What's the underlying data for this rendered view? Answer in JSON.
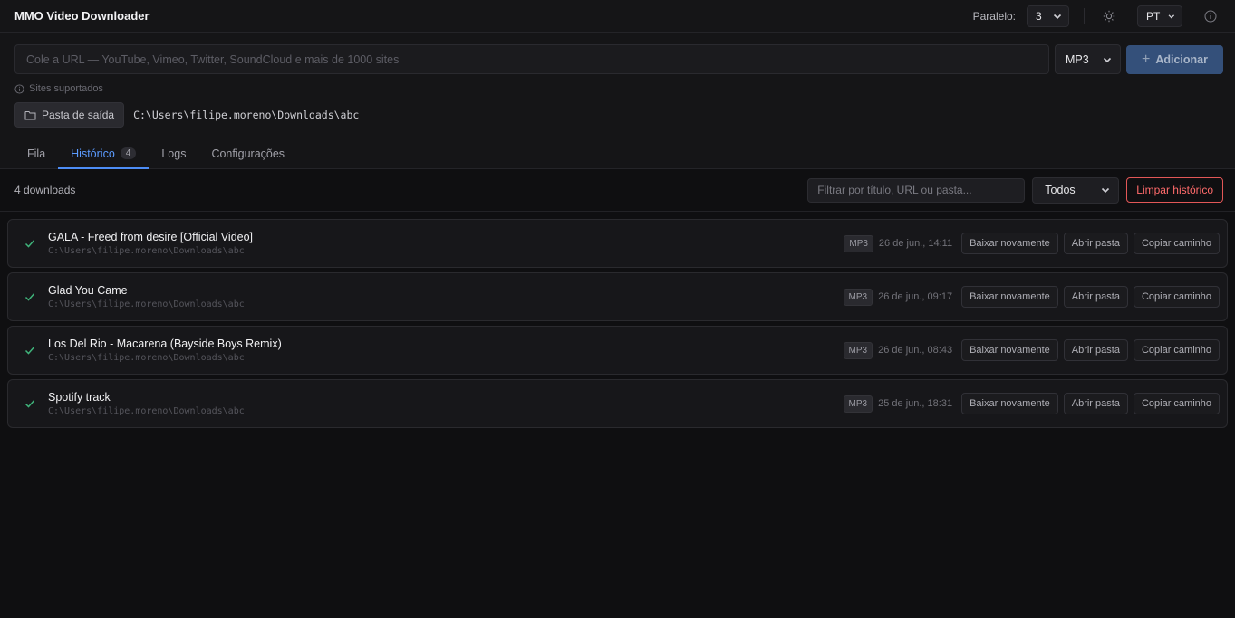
{
  "app": {
    "title": "MMO Video Downloader",
    "parallel_label": "Paralelo:",
    "parallel_value": "3",
    "language": "PT"
  },
  "input": {
    "url_placeholder": "Cole a URL — YouTube, Vimeo, Twitter, SoundCloud e mais de 1000 sites",
    "format": "MP3",
    "add_label": "Adicionar",
    "supported_label": "Sites suportados",
    "folder_button": "Pasta de saída",
    "folder_path": "C:\\Users\\filipe.moreno\\Downloads\\abc"
  },
  "tabs": [
    {
      "label": "Fila",
      "badge": ""
    },
    {
      "label": "Histórico",
      "badge": "4"
    },
    {
      "label": "Logs",
      "badge": ""
    },
    {
      "label": "Configurações",
      "badge": ""
    }
  ],
  "toolbar": {
    "count_label": "4 downloads",
    "filter_placeholder": "Filtrar por título, URL ou pasta...",
    "status_filter": "Todos",
    "clear_label": "Limpar histórico"
  },
  "actions": {
    "redownload": "Baixar novamente",
    "open_folder": "Abrir pasta",
    "copy_path": "Copiar caminho"
  },
  "history": [
    {
      "title": "GALA - Freed from desire [Official Video]",
      "path": "C:\\Users\\filipe.moreno\\Downloads\\abc",
      "format": "MP3",
      "date": "26 de jun., 14:11"
    },
    {
      "title": "Glad You Came",
      "path": "C:\\Users\\filipe.moreno\\Downloads\\abc",
      "format": "MP3",
      "date": "26 de jun., 09:17"
    },
    {
      "title": "Los Del Rio - Macarena (Bayside Boys Remix)",
      "path": "C:\\Users\\filipe.moreno\\Downloads\\abc",
      "format": "MP3",
      "date": "26 de jun., 08:43"
    },
    {
      "title": "Spotify track",
      "path": "C:\\Users\\filipe.moreno\\Downloads\\abc",
      "format": "MP3",
      "date": "25 de jun., 18:31"
    }
  ],
  "colors": {
    "accent": "#4d8df6",
    "success": "#3fb37a",
    "danger": "#e25757"
  },
  "icons": {
    "theme": "sun-icon",
    "about": "info-icon",
    "folder": "folder-icon",
    "success": "check-icon"
  }
}
